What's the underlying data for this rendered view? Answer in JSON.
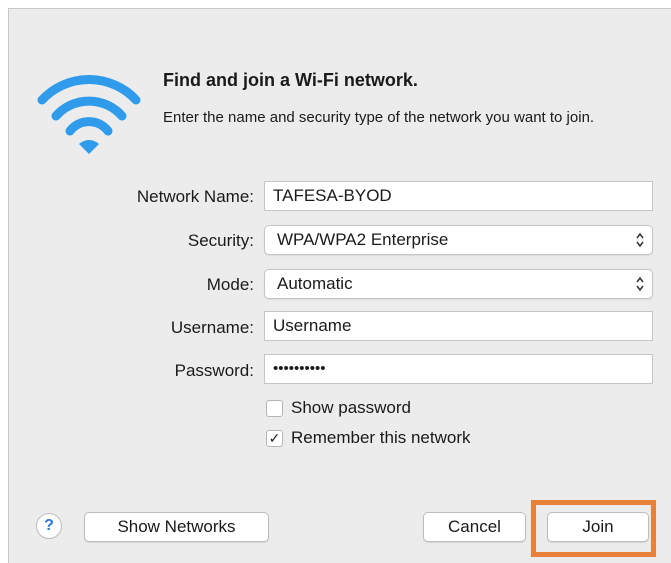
{
  "dialog": {
    "heading": "Find and join a Wi-Fi network.",
    "description": "Enter the name and security type of the network you want to join."
  },
  "form": {
    "network_name": {
      "label": "Network Name:",
      "value": "TAFESA-BYOD"
    },
    "security": {
      "label": "Security:",
      "value": "WPA/WPA2 Enterprise"
    },
    "mode": {
      "label": "Mode:",
      "value": "Automatic"
    },
    "username": {
      "label": "Username:",
      "value": "Username"
    },
    "password": {
      "label": "Password:",
      "value": "••••••••••"
    },
    "show_password": {
      "label": "Show password",
      "checked": false
    },
    "remember_network": {
      "label": "Remember this network",
      "checked": true,
      "mark": "✓"
    }
  },
  "buttons": {
    "help": "?",
    "show_networks": "Show Networks",
    "cancel": "Cancel",
    "join": "Join"
  },
  "colors": {
    "wifi_icon": "#2f9bea",
    "highlight": "#e8823a",
    "help_icon": "#2a7bd6"
  },
  "icons": {
    "wifi": "wifi-icon",
    "select_arrows": "updown-arrows-icon"
  }
}
